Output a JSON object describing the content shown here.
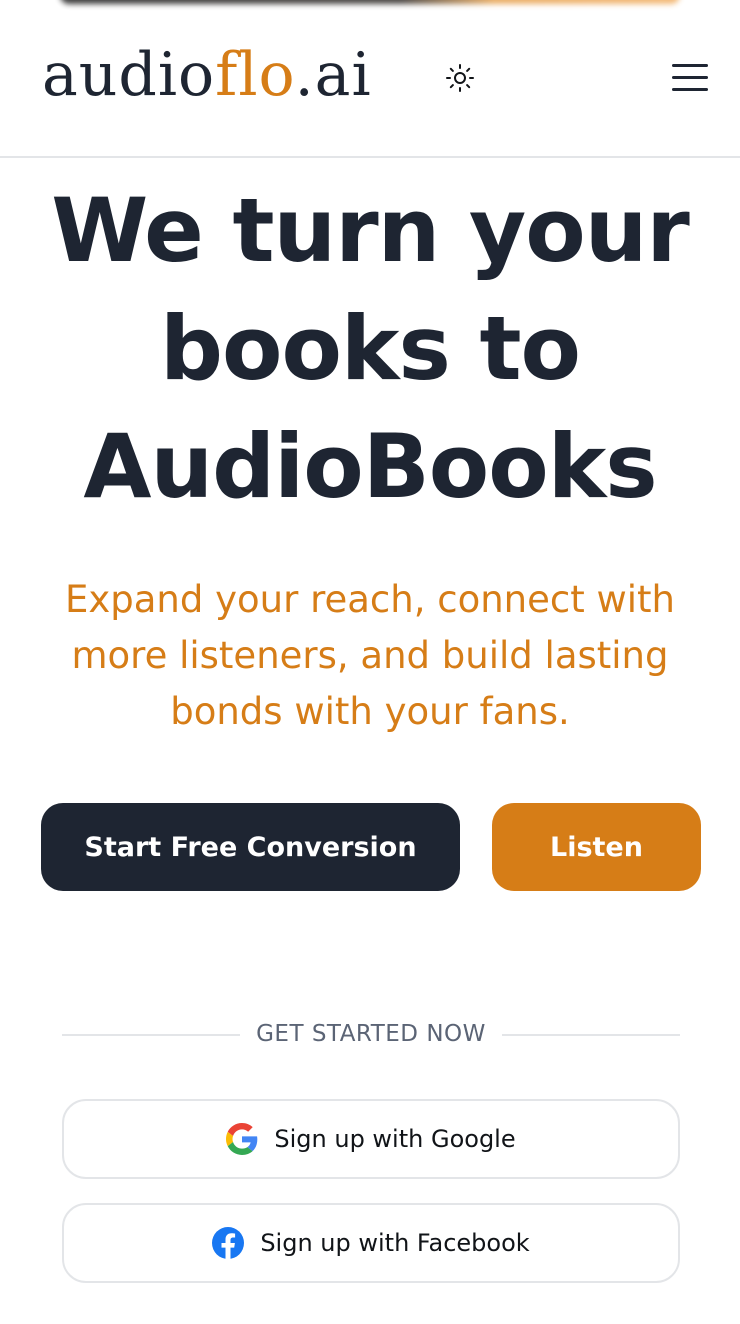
{
  "header": {
    "logo": {
      "part_a": "audio",
      "part_b": "flo",
      "part_c": ".ai"
    },
    "theme_toggle_icon": "sun-icon",
    "menu_icon": "hamburger-menu-icon"
  },
  "hero": {
    "title_line_1": "We turn your",
    "title_line_2": "books to",
    "title_line_3": "AudioBooks",
    "subtitle_line_1": "Expand your reach, connect with",
    "subtitle_line_2": "more listeners, and build lasting",
    "subtitle_line_3": "bonds with your fans."
  },
  "cta": {
    "primary_label": "Start Free Conversion",
    "secondary_label": "Listen"
  },
  "signup": {
    "divider_text": "GET STARTED NOW",
    "google_label": "Sign up with Google",
    "facebook_label": "Sign up with Facebook"
  },
  "colors": {
    "brand_dark": "#1e2532",
    "brand_accent": "#d67d17",
    "divider": "#e3e5e8",
    "muted_text": "#5b6475"
  }
}
